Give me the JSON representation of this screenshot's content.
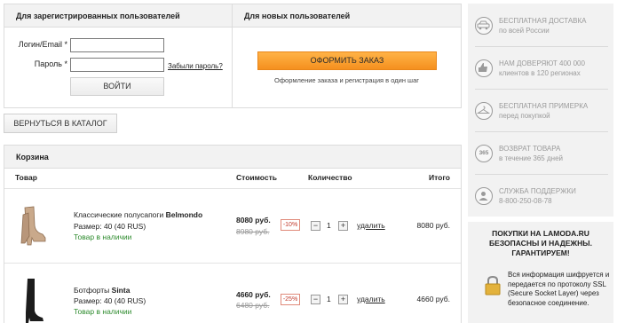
{
  "login": {
    "title": "Для зарегистрированных пользователей",
    "login_label": "Логин/Email *",
    "password_label": "Пароль *",
    "login_value": "",
    "password_value": "",
    "forgot_link": "Забыли пароль?",
    "submit": "ВОЙТИ"
  },
  "new_users": {
    "title": "Для новых пользователей",
    "checkout_button": "ОФОРМИТЬ ЗАКАЗ",
    "note": "Оформление заказа и регистрация в один шаг"
  },
  "back_button": "ВЕРНУТЬСЯ В КАТАЛОГ",
  "cart": {
    "title": "Корзина",
    "columns": {
      "product": "Товар",
      "cost": "Стоимость",
      "quantity": "Количество",
      "total": "Итого"
    },
    "items": [
      {
        "name": "Классические полусапоги",
        "brand": "Belmondo",
        "size": "Размер: 40 (40 RUS)",
        "stock": "Товар в наличии",
        "price": "8080 руб.",
        "old_price": "8980 руб.",
        "discount": "-10%",
        "minus": "−",
        "qty": "1",
        "plus": "+",
        "delete": "удалить",
        "total": "8080 руб."
      },
      {
        "name": "Ботфорты",
        "brand": "Sinta",
        "size": "Размер: 40 (40 RUS)",
        "stock": "Товар в наличии",
        "price": "4660 руб.",
        "old_price": "6480 руб.",
        "discount": "-25%",
        "minus": "−",
        "qty": "1",
        "plus": "+",
        "delete": "удалить",
        "total": "4660 руб."
      }
    ]
  },
  "sidebar": {
    "benefits": [
      {
        "icon": "car-icon",
        "line1": "БЕСПЛАТНАЯ ДОСТАВКА",
        "line2": "по всей России"
      },
      {
        "icon": "thumbs-up-icon",
        "line1": "НАМ ДОВЕРЯЮТ 400 000",
        "line2": "клиентов в 120 регионах"
      },
      {
        "icon": "hanger-icon",
        "line1": "БЕСПЛАТНАЯ ПРИМЕРКА",
        "line2": "перед покупкой"
      },
      {
        "icon": "return-365-icon",
        "icon_text": "365",
        "line1": "ВОЗВРАТ ТОВАРА",
        "line2": "в течение 365 дней"
      },
      {
        "icon": "support-icon",
        "line1": "СЛУЖБА ПОДДЕРЖКИ",
        "line2": "8-800-250-08-78"
      }
    ],
    "secure_title": "ПОКУПКИ НА LAMODA.RU БЕЗОПАСНЫ И НАДЕЖНЫ. ГАРАНТИРУЕМ!",
    "secure_text": "Вся информация шифруется и передается по протоколу SSL (Secure Socket Layer) через безопасное соединение."
  },
  "colors": {
    "accent_orange": "#f5901e",
    "stock_green": "#2e8b2e",
    "discount_red": "#c0392b",
    "sidebar_grey": "#f2f2f2"
  }
}
